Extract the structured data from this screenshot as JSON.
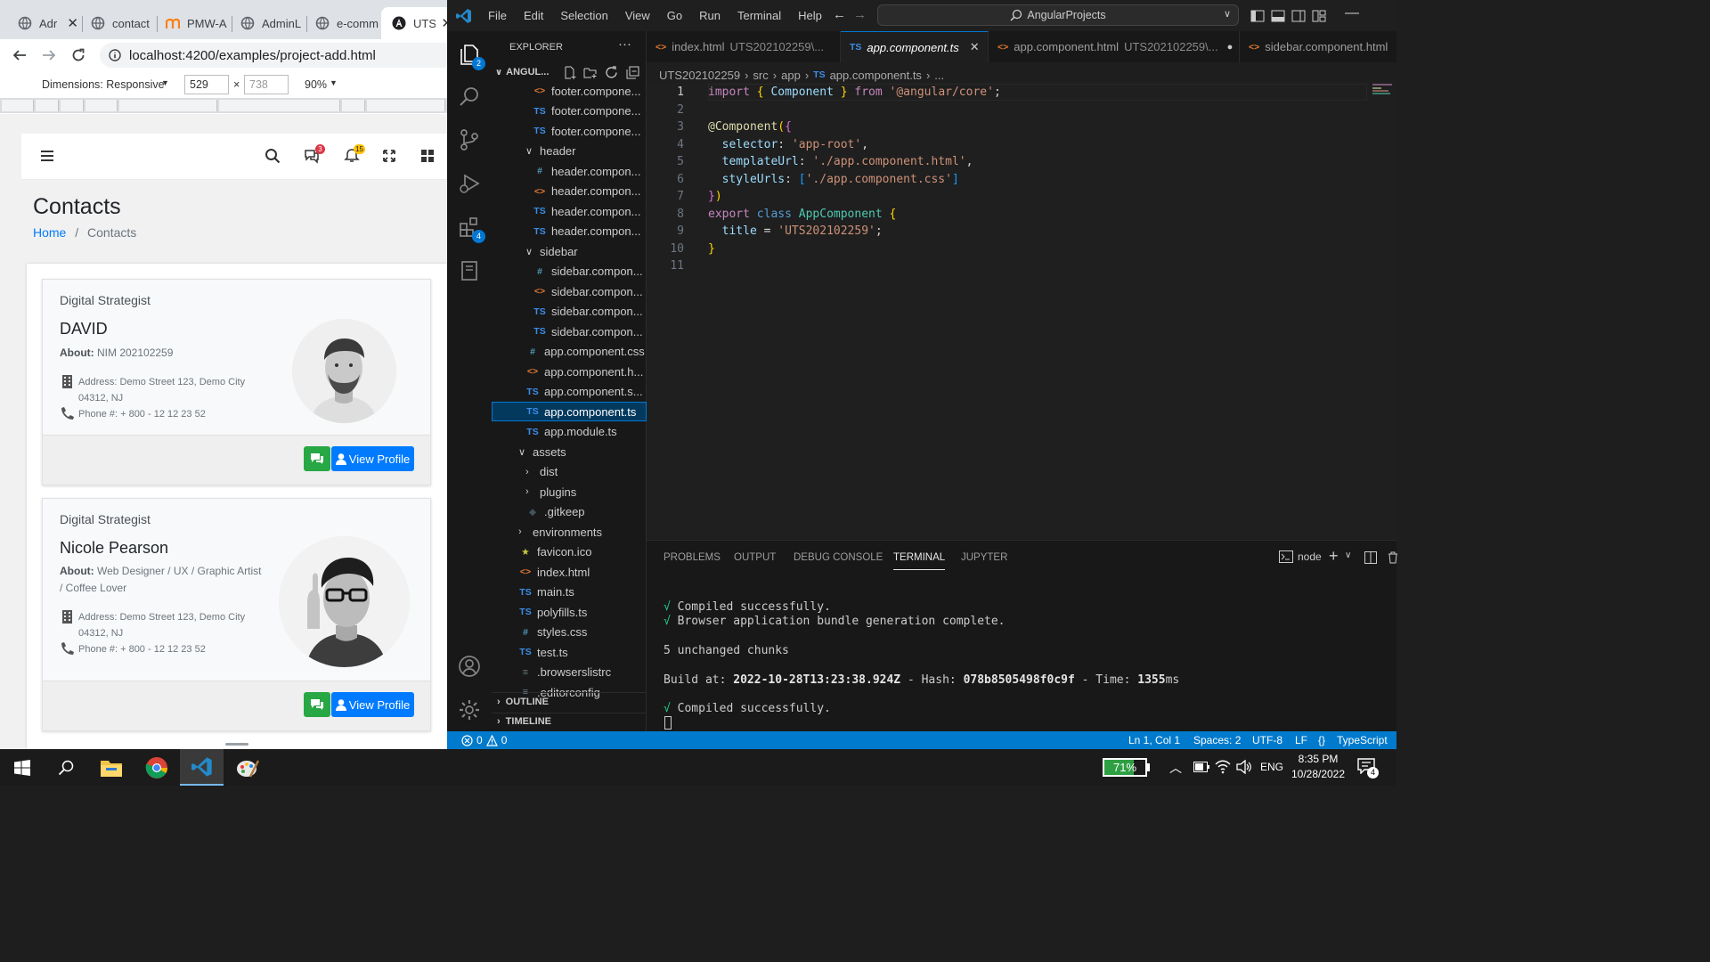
{
  "browser": {
    "tabs": [
      {
        "label": "Adr",
        "icon": "globe-icon"
      },
      {
        "label": "contact",
        "icon": "globe-icon"
      },
      {
        "label": "PMW-A",
        "icon": "moodle-icon"
      },
      {
        "label": "AdminL",
        "icon": "globe-icon"
      },
      {
        "label": "e-comm",
        "icon": "globe-icon"
      },
      {
        "label": "UTS",
        "icon": "angular-icon"
      }
    ],
    "url": "localhost:4200/examples/project-add.html",
    "device_toolbar": {
      "dimensions_label": "Dimensions: Responsive",
      "width": "529",
      "x": "×",
      "height": "738",
      "zoom": "90%"
    },
    "page": {
      "title": "Contacts",
      "breadcrumb": {
        "home": "Home",
        "separator": "/",
        "current": "Contacts"
      },
      "header_badges": {
        "messages": "3",
        "notifications": "15"
      },
      "contacts": [
        {
          "role": "Digital Strategist",
          "name": "DAVID",
          "about_label": "About:",
          "about": "NIM 202102259",
          "address_line1": "Address: Demo Street 123, Demo City",
          "address_line2": "04312, NJ",
          "phone": "Phone #: + 800 - 12 12 23 52",
          "view_label": "View Profile"
        },
        {
          "role": "Digital Strategist",
          "name": "Nicole Pearson",
          "about_label": "About:",
          "about_line1": "Web Designer / UX / Graphic Artist",
          "about_line2": "/ Coffee Lover",
          "address_line1": "Address: Demo Street 123, Demo City",
          "address_line2": "04312, NJ",
          "phone": "Phone #: + 800 - 12 12 23 52",
          "view_label": "View Profile"
        }
      ]
    }
  },
  "vscode": {
    "menu": [
      "File",
      "Edit",
      "Selection",
      "View",
      "Go",
      "Run",
      "Terminal",
      "Help"
    ],
    "search": "AngularProjects",
    "activity_badges": {
      "explorer": "2",
      "extensions": "4"
    },
    "explorer": {
      "title": "EXPLORER",
      "root": "ANGUL...",
      "items": [
        {
          "name": "footer.compone...",
          "type": "html"
        },
        {
          "name": "footer.compone...",
          "type": "ts"
        },
        {
          "name": "footer.compone...",
          "type": "ts"
        },
        {
          "name": "header",
          "type": "folder-open"
        },
        {
          "name": "header.compon...",
          "type": "css"
        },
        {
          "name": "header.compon...",
          "type": "html"
        },
        {
          "name": "header.compon...",
          "type": "ts"
        },
        {
          "name": "header.compon...",
          "type": "ts"
        },
        {
          "name": "sidebar",
          "type": "folder-open"
        },
        {
          "name": "sidebar.compon...",
          "type": "css"
        },
        {
          "name": "sidebar.compon...",
          "type": "html"
        },
        {
          "name": "sidebar.compon...",
          "type": "ts"
        },
        {
          "name": "sidebar.compon...",
          "type": "ts"
        },
        {
          "name": "app.component.css",
          "type": "css"
        },
        {
          "name": "app.component.h...",
          "type": "html"
        },
        {
          "name": "app.component.s...",
          "type": "ts"
        },
        {
          "name": "app.component.ts",
          "type": "ts"
        },
        {
          "name": "app.module.ts",
          "type": "ts"
        },
        {
          "name": "assets",
          "type": "folder-open"
        },
        {
          "name": "dist",
          "type": "folder"
        },
        {
          "name": "plugins",
          "type": "folder"
        },
        {
          "name": ".gitkeep",
          "type": "git"
        },
        {
          "name": "environments",
          "type": "folder"
        },
        {
          "name": "favicon.ico",
          "type": "fav"
        },
        {
          "name": "index.html",
          "type": "html"
        },
        {
          "name": "main.ts",
          "type": "ts"
        },
        {
          "name": "polyfills.ts",
          "type": "ts"
        },
        {
          "name": "styles.css",
          "type": "css"
        },
        {
          "name": "test.ts",
          "type": "ts"
        },
        {
          "name": ".browserslistrc",
          "type": "cfg"
        },
        {
          "name": ".editorconfig",
          "type": "cfg"
        }
      ],
      "outline": "OUTLINE",
      "timeline": "TIMELINE"
    },
    "editor_tabs": [
      {
        "name": "index.html",
        "dir": "UTS202102259\\...",
        "type": "html"
      },
      {
        "name": "app.component.ts",
        "type": "ts",
        "close": "✕"
      },
      {
        "name": "app.component.html",
        "dir": "UTS202102259\\...",
        "type": "html",
        "dot": "●"
      },
      {
        "name": "sidebar.component.html",
        "type": "html"
      }
    ],
    "breadcrumb": {
      "root": "UTS202102259",
      "src": "src",
      "app": "app",
      "file": "app.component.ts",
      "rest": "..."
    },
    "line_numbers": [
      "1",
      "2",
      "3",
      "4",
      "5",
      "6",
      "7",
      "8",
      "9",
      "10",
      "11"
    ],
    "code": {
      "l1": {
        "import": "import",
        "ob": "{",
        "comp": "Component",
        "cb": "}",
        "from": "from",
        "mod": "'@angular/core'",
        "semi": ";"
      },
      "l3": {
        "at": "@Component",
        "p1": "(",
        "b": "{"
      },
      "l4": {
        "key": "selector",
        "colon": ": ",
        "val": "'app-root'",
        "comma": ","
      },
      "l5": {
        "key": "templateUrl",
        "colon": ": ",
        "val": "'./app.component.html'",
        "comma": ","
      },
      "l6": {
        "key": "styleUrls",
        "colon": ": ",
        "ob": "[",
        "val": "'./app.component.css'",
        "cb": "]"
      },
      "l7": {
        "b": "}",
        "p": ")"
      },
      "l8": {
        "export": "export",
        "class": "class",
        "name": "AppComponent",
        "b": "{"
      },
      "l9": {
        "key": "title",
        "eq": " = ",
        "val": "'UTS202102259'",
        "semi": ";"
      },
      "l10": {
        "b": "}"
      }
    },
    "panel": {
      "tabs": [
        "PROBLEMS",
        "OUTPUT",
        "DEBUG CONSOLE",
        "TERMINAL",
        "JUPYTER"
      ],
      "terminal_name": "node",
      "lines": {
        "check": "√",
        "compiled": "Compiled successfully.",
        "bundle": "Browser application bundle generation complete.",
        "chunks": "5 unchanged chunks",
        "build_label": "Build at: ",
        "build_time": "2022-10-28T13:23:38.924Z",
        "hash_label": " - Hash: ",
        "hash": "078b8505498f0c9f",
        "time_label": " - Time: ",
        "time": "1355",
        "ms": "ms"
      }
    },
    "status": {
      "errors": "0",
      "warnings": "0",
      "position": "Ln 1, Col 1",
      "spaces": "Spaces: 2",
      "encoding": "UTF-8",
      "eol": "LF",
      "language": "TypeScript",
      "brackets": "{}"
    }
  },
  "taskbar": {
    "battery": "71%",
    "language": "ENG",
    "time": "8:35 PM",
    "date": "10/28/2022",
    "notifications": "4"
  },
  "colors": {
    "vscode_blue": "#007acc",
    "bootstrap_blue": "#007bff",
    "bootstrap_green": "#28a745"
  }
}
